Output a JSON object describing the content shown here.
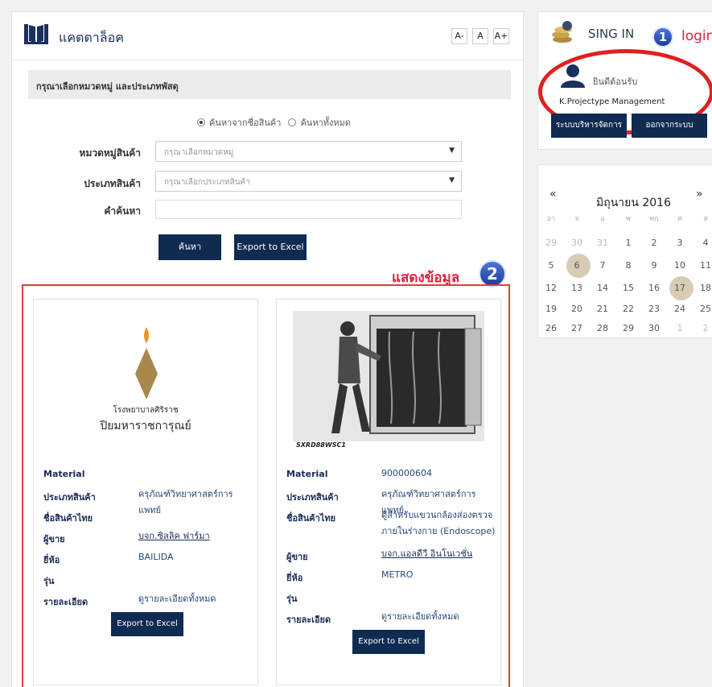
{
  "catalog": {
    "title": "แคตตาล็อค",
    "font_size_buttons": [
      "A-",
      "A",
      "A+"
    ],
    "section_title": "กรุณาเลือกหมวดหมู่ และประเภทพัสดุ",
    "search_options": [
      "ค้นหาจากชื่อสินค้า",
      "ค้นหาทั้งหมด"
    ],
    "selected_search_option": "ค้นหาจากชื่อสินค้า",
    "fields": {
      "category_label": "หมวดหมู่สินค้า",
      "category_placeholder": "กรุณาเลือกหมวดหมู่",
      "type_label": "ประเภทสินค้า",
      "type_placeholder": "กรุณาเลือกประเภทสินค้า",
      "keyword_label": "คำค้นหา",
      "keyword_value": ""
    },
    "search_button": "ค้นหา",
    "export_button": "Export to Excel"
  },
  "annotations": {
    "show_data_label": "แสดงข้อมูล",
    "badge_1": "1",
    "badge_2": "2",
    "login_label": "login"
  },
  "products": [
    {
      "logo_text_1": "โรงพยาบาลศิริราช",
      "logo_text_2": "ปิยมหาราชการุณย์",
      "labels": [
        "Material",
        "ประเภทสินค้า",
        "ชื่อสินค้าไทย",
        "ผู้ขาย",
        "ยี่ห้อ",
        "รุ่น",
        "รายละเอียด"
      ],
      "material": "",
      "product_type": "ครุภัณฑ์วิทยาศาสตร์การแพทย์",
      "thai_name": "",
      "vendor": "บจก.ซิลลิค ฟาร์มา",
      "brand": "BAILIDA",
      "model": "",
      "details_link": "ดูรายละเอียดทั้งหมด",
      "export_button": "Export to Excel"
    },
    {
      "image_caption": "SXRD88WSC1",
      "labels": [
        "Material",
        "ประเภทสินค้า",
        "ชื่อสินค้าไทย",
        "ผู้ขาย",
        "ยี่ห้อ",
        "รุ่น",
        "รายละเอียด"
      ],
      "material": "900000604",
      "product_type": "ครุภัณฑ์วิทยาศาสตร์การแพทย์",
      "thai_name": "ตู้สำหรับแขวนกล้องส่องตรวจภายในร่างกาย (Endoscope)",
      "vendor": "บจก.แอลดีวี อินโนเวชั่น",
      "brand": "METRO",
      "model": "",
      "details_link": "ดูรายละเอียดทั้งหมด",
      "export_button": "Export to Excel"
    }
  ],
  "signin": {
    "title": "SING IN",
    "welcome": "ยินดีต้อนรับ",
    "user_name": "K.Projectype Management",
    "admin_button": "ระบบบริหารจัดการ",
    "logout_button": "ออกจากระบบ"
  },
  "calendar": {
    "month_title": "มิถุนายน 2016",
    "prev": "«",
    "next": "»",
    "weekdays": [
      "อา",
      "จ",
      "อ",
      "พ",
      "พฤ",
      "ศ",
      "ส"
    ],
    "weeks": [
      [
        "29",
        "30",
        "31",
        "1",
        "2",
        "3",
        "4"
      ],
      [
        "5",
        "6",
        "7",
        "8",
        "9",
        "10",
        "11"
      ],
      [
        "12",
        "13",
        "14",
        "15",
        "16",
        "17",
        "18"
      ],
      [
        "19",
        "20",
        "21",
        "22",
        "23",
        "24",
        "25"
      ],
      [
        "26",
        "27",
        "28",
        "29",
        "30",
        "1",
        "2"
      ]
    ],
    "highlighted_days": [
      "6",
      "17"
    ]
  },
  "colors": {
    "navy": "#0f2b52",
    "annotation_red": "#e0203a",
    "highlight_day": "#d8ccb4"
  }
}
